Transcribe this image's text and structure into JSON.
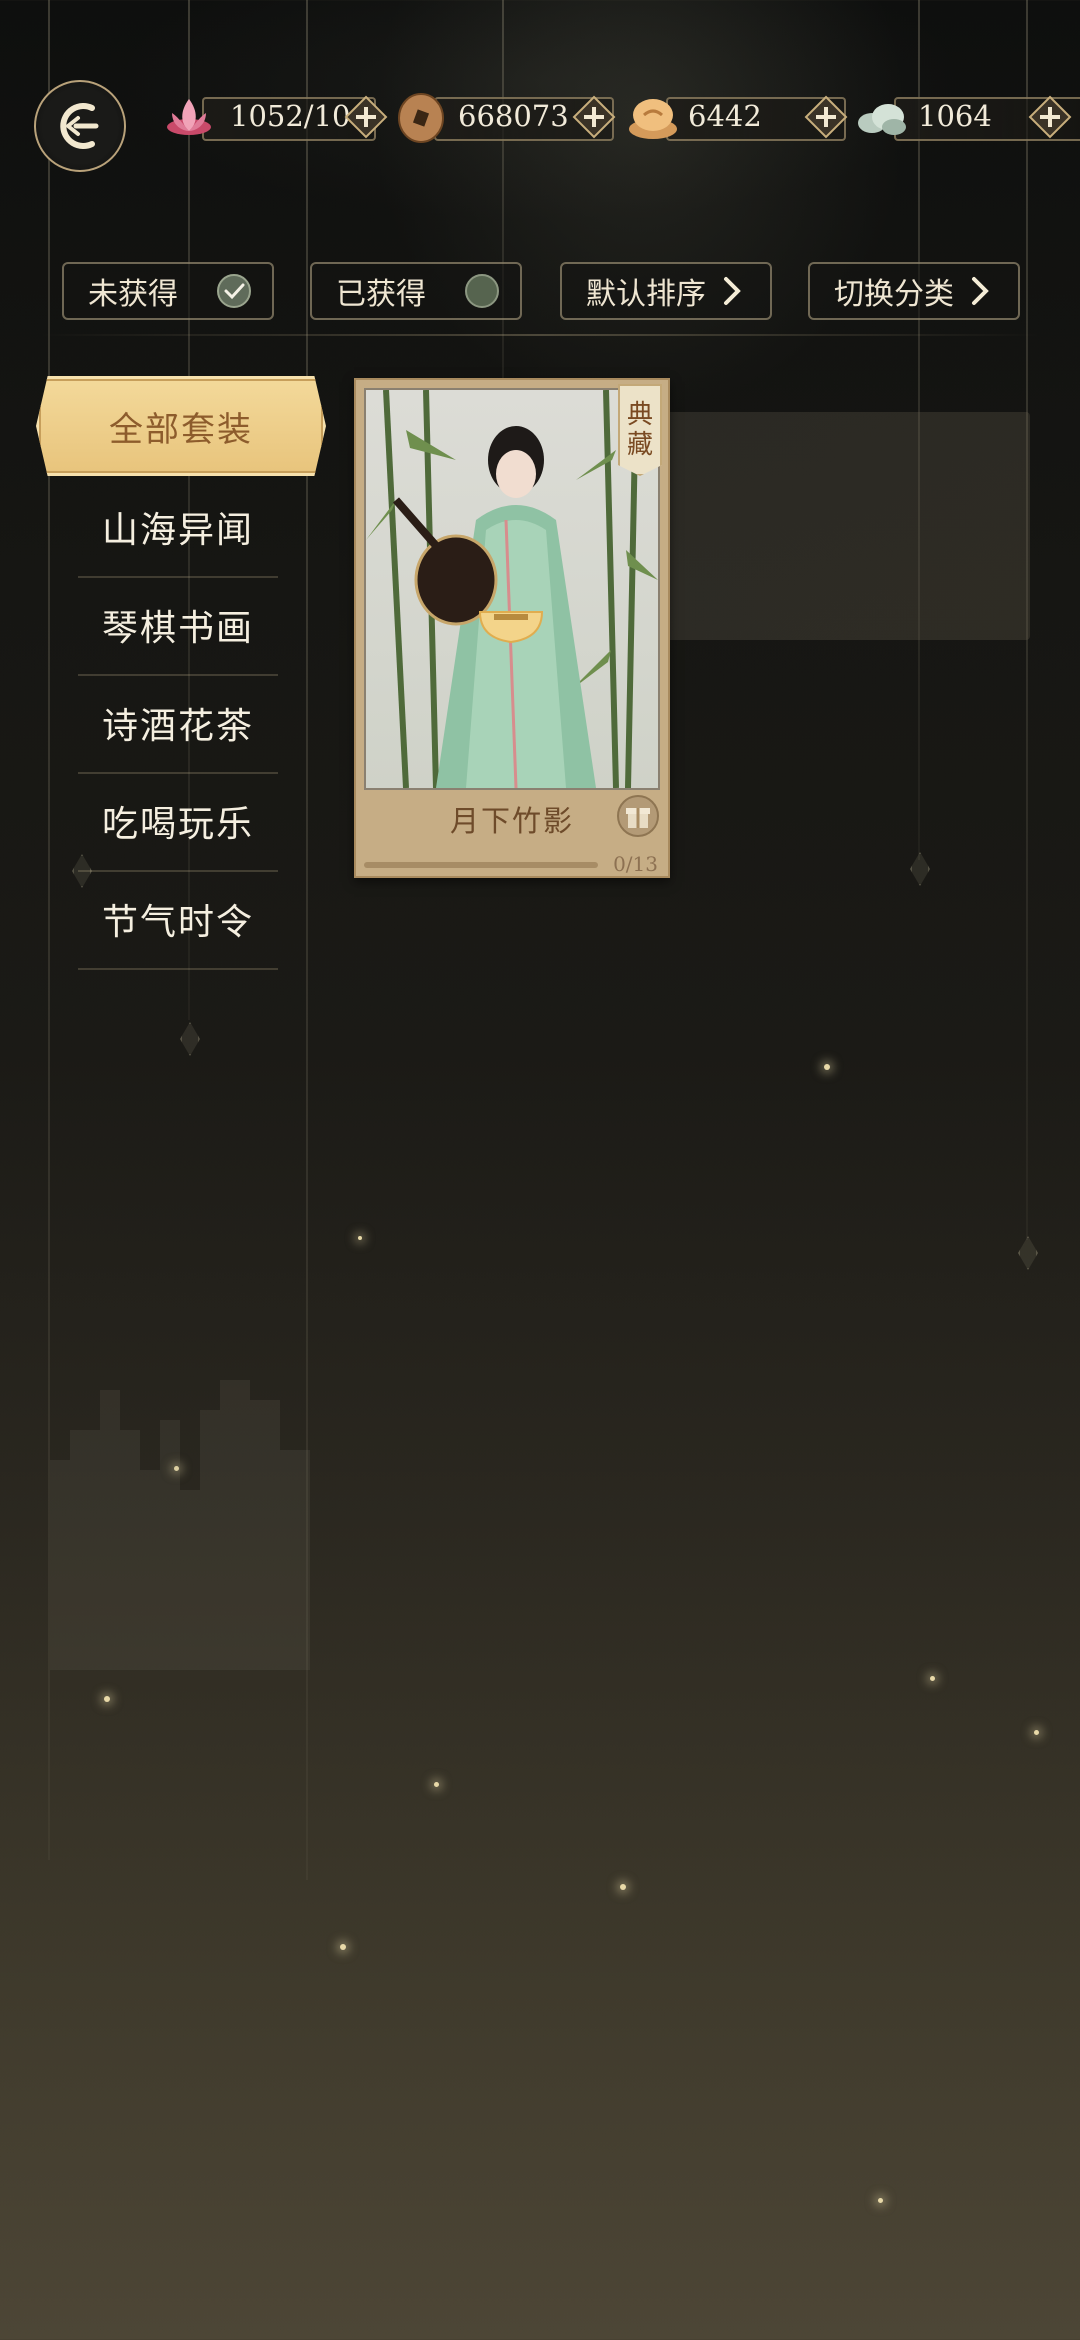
{
  "currencies": [
    {
      "name": "lotus-energy",
      "value": "1052/10",
      "icon": "lotus-icon"
    },
    {
      "name": "copper-coin",
      "value": "668073",
      "icon": "coin-icon"
    },
    {
      "name": "gold-ingot",
      "value": "6442",
      "icon": "ingot-icon"
    },
    {
      "name": "cloud-jade",
      "value": "1064",
      "icon": "cloud-icon"
    }
  ],
  "filters": [
    {
      "label": "未获得",
      "icon": "check-icon"
    },
    {
      "label": "已获得",
      "icon": "circle-icon"
    },
    {
      "label": "默认排序",
      "icon": "chevron-right-icon"
    },
    {
      "label": "切换分类",
      "icon": "chevron-right-icon"
    }
  ],
  "sidebar": {
    "active": "全部套装",
    "items": [
      "山海异闻",
      "琴棋书画",
      "诗酒花茶",
      "吃喝玩乐",
      "节气时令"
    ]
  },
  "card": {
    "badge_top": "典",
    "badge_bottom": "藏",
    "title": "月下竹影",
    "progress": "0/13",
    "progress_fraction": 0
  },
  "colors": {
    "accent": "#e8c47c",
    "card": "#c6ad85"
  }
}
